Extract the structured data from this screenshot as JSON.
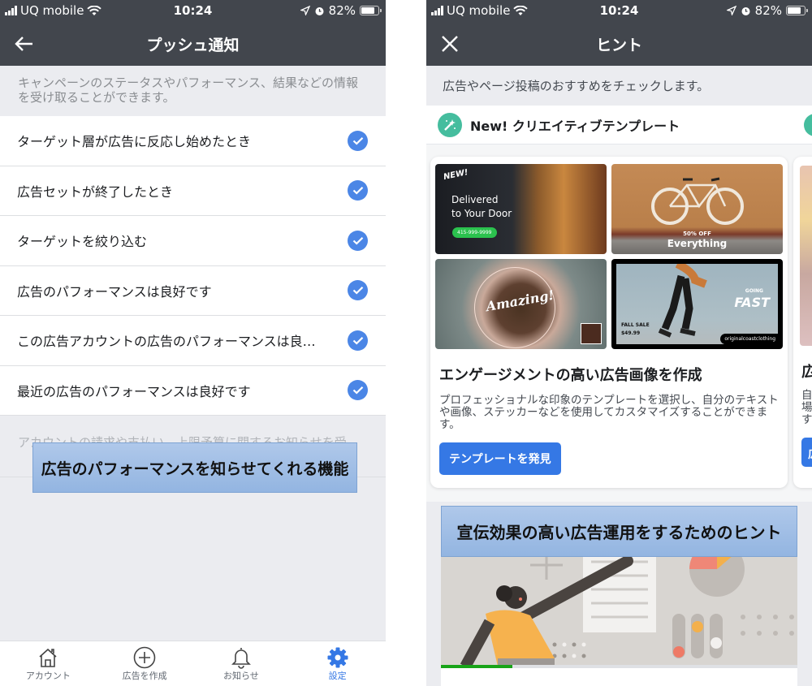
{
  "status_bar": {
    "carrier": "UQ mobile",
    "time": "10:24",
    "battery": "82%",
    "battery_level": 0.82,
    "icons": [
      "signal-icon",
      "wifi-icon",
      "location-arrow-icon",
      "alarm-icon",
      "battery-icon"
    ]
  },
  "left_screen": {
    "nav": {
      "title": "プッシュ通知",
      "back_icon": "arrow-left-icon"
    },
    "description": "キャンペーンのステータスやパフォーマンス、結果などの情報を受け取ることができます。",
    "items": [
      {
        "label": "ターゲット層が広告に反応し始めたとき",
        "checked": true
      },
      {
        "label": "広告セットが終了したとき",
        "checked": true
      },
      {
        "label": "ターゲットを絞り込む",
        "checked": true
      },
      {
        "label": "広告のパフォーマンスは良好です",
        "checked": true
      },
      {
        "label": "この広告アカウントの広告のパフォーマンスは良…",
        "checked": true
      },
      {
        "label": "最近の広告のパフォーマンスは良好です",
        "checked": true
      }
    ],
    "description2": "アカウントの請求や支払い、上限予算に関するお知らせを受",
    "overlay_caption": "広告のパフォーマンスを知らせてくれる機能",
    "tabbar": [
      {
        "label": "アカウント",
        "icon": "home-icon",
        "active": false
      },
      {
        "label": "広告を作成",
        "icon": "plus-circle-icon",
        "active": false
      },
      {
        "label": "お知らせ",
        "icon": "bell-icon",
        "active": false
      },
      {
        "label": "設定",
        "icon": "gear-icon",
        "active": true
      }
    ]
  },
  "right_screen": {
    "nav": {
      "title": "ヒント",
      "close_icon": "close-icon"
    },
    "description": "広告やページ投稿のおすすめをチェックします。",
    "section": {
      "title": "New! クリエイティブテンプレート",
      "icon": "magic-wand-icon"
    },
    "card": {
      "thumbnails": [
        {
          "name": "burger",
          "badge": "NEW!",
          "line1": "Delivered",
          "line2": "to Your Door",
          "phone": "415-999-9999"
        },
        {
          "name": "bicycle",
          "small": "50% OFF",
          "big": "Everything"
        },
        {
          "name": "coffee",
          "text": "Amazing!"
        },
        {
          "name": "skate",
          "small": "GOING",
          "big": "FAST",
          "sale": "FALL SALE",
          "price": "$49.99",
          "handle": "originalcoastclothing"
        }
      ],
      "title": "エンゲージメントの高い広告画像を作成",
      "body": "プロフェッショナルな印象のテンプレートを選択し、自分のテキストや画像、ステッカーなどを使用してカスタマイズすることができます。",
      "button": "テンプレートを発見"
    },
    "peek_card": {
      "title": "広",
      "body_lines": [
        "自",
        "場",
        "す"
      ],
      "button": "広"
    },
    "overlay_caption": "宣伝効果の高い広告運用をするためのヒント",
    "progress": 0.2,
    "colors": {
      "accent": "#3578e5",
      "nav_bg": "#42464d",
      "progress": "#18a418",
      "section_icon": "#45bd9e"
    }
  }
}
